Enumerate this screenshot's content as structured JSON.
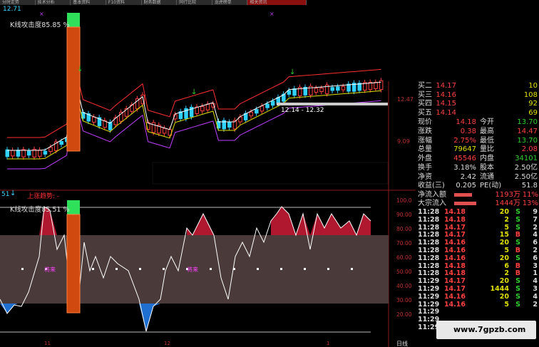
{
  "tabs": [
    "分时走势",
    "技术分析",
    "基本资料",
    "F10资料",
    "财务数据",
    "同行比较",
    "龙虎榜单",
    "相关资讯"
  ],
  "main_chart": {
    "top_price": "12.71",
    "indicator_label": "K线攻击度85.85 %",
    "range_label": "12.14 - 12.32",
    "axis_prices": [
      "12.47",
      "9.09"
    ]
  },
  "sub_chart": {
    "header_num": "51",
    "header_title": "上涨趋势: -",
    "indicator_label": "K线攻击度85.51 %",
    "axis_ticks": [
      "100.0",
      "90.00",
      "80.00",
      "70.00",
      "60.00",
      "50.00",
      "40.00",
      "30.00",
      "20.00"
    ],
    "marker_label": "将来",
    "bottom_tab": "日线",
    "x_labels": [
      "11",
      "12",
      "1"
    ]
  },
  "order_book": [
    {
      "label": "买二",
      "price": "14.17",
      "vol": "10"
    },
    {
      "label": "买三",
      "price": "14.16",
      "vol": "108"
    },
    {
      "label": "买四",
      "price": "14.15",
      "vol": "92"
    },
    {
      "label": "买五",
      "price": "14.14",
      "vol": "69"
    }
  ],
  "quote": [
    {
      "l1": "现价",
      "v1": "14.18",
      "c1": "#ff4040",
      "l2": "今开",
      "v2": "13.70",
      "c2": "#30d030"
    },
    {
      "l1": "涨跌",
      "v1": "0.38",
      "c1": "#ff4040",
      "l2": "最高",
      "v2": "14.47",
      "c2": "#ff4040"
    },
    {
      "l1": "涨幅",
      "v1": "2.75%",
      "c1": "#ff4040",
      "l2": "最低",
      "v2": "13.70",
      "c2": "#30d030"
    },
    {
      "l1": "总量",
      "v1": "79647",
      "c1": "#e0e000",
      "l2": "量比",
      "v2": "2.08",
      "c2": "#ff4040"
    },
    {
      "l1": "外盘",
      "v1": "45546",
      "c1": "#ff4040",
      "l2": "内盘",
      "v2": "34101",
      "c2": "#30d030"
    }
  ],
  "stats": [
    {
      "l1": "换手",
      "v1": "3.18%",
      "l2": "股本",
      "v2": "2.50亿"
    },
    {
      "l1": "净资",
      "v1": "2.42",
      "l2": "流通",
      "v2": "2.50亿"
    },
    {
      "l1": "收益(三)",
      "v1": "0.205",
      "l2": "PE(动)",
      "v2": "51.8"
    }
  ],
  "flows": [
    {
      "label": "净流入额",
      "value": "1193万",
      "pct": "11%",
      "bar": 0.62
    },
    {
      "label": "大宗流入",
      "value": "1444万",
      "pct": "13%",
      "bar": 0.78
    }
  ],
  "trades": [
    {
      "t": "11:28",
      "p": "14.18",
      "v": "20",
      "d": "S",
      "n": "9"
    },
    {
      "t": "11:28",
      "p": "14.18",
      "v": "2",
      "d": "S",
      "n": "7"
    },
    {
      "t": "11:28",
      "p": "14.17",
      "v": "5",
      "d": "S",
      "n": "2"
    },
    {
      "t": "11:28",
      "p": "14.17",
      "v": "15",
      "d": "B",
      "n": "4"
    },
    {
      "t": "11:28",
      "p": "14.16",
      "v": "20",
      "d": "S",
      "n": "6"
    },
    {
      "t": "11:28",
      "p": "14.16",
      "v": "5",
      "d": "B",
      "n": "2"
    },
    {
      "t": "11:28",
      "p": "14.16",
      "v": "20",
      "d": "S",
      "n": "6"
    },
    {
      "t": "11:28",
      "p": "14.18",
      "v": "6",
      "d": "B",
      "n": "3"
    },
    {
      "t": "11:28",
      "p": "14.18",
      "v": "2",
      "d": "B",
      "n": "1"
    },
    {
      "t": "11:29",
      "p": "14.17",
      "v": "20",
      "d": "S",
      "n": "4"
    },
    {
      "t": "11:29",
      "p": "14.17",
      "v": "1444",
      "d": "S",
      "n": "3"
    },
    {
      "t": "11:29",
      "p": "14.16",
      "v": "20",
      "d": "S",
      "n": "4"
    },
    {
      "t": "11:29",
      "p": "14.16",
      "v": "5",
      "d": "S",
      "n": "2"
    },
    {
      "t": "11:29",
      "p": "",
      "v": "",
      "d": "",
      "n": ""
    },
    {
      "t": "11:29",
      "p": "",
      "v": "",
      "d": "",
      "n": ""
    },
    {
      "t": "11:29",
      "p": "",
      "v": "",
      "d": "",
      "n": ""
    }
  ],
  "watermark": "www.7gpzb.com",
  "colors": {
    "up": "#ff4040",
    "down": "#30d030",
    "label": "#ffd000",
    "fill_red": "#b01830",
    "fill_blue": "#1f6fd0",
    "band": "#4a3a3a"
  }
}
